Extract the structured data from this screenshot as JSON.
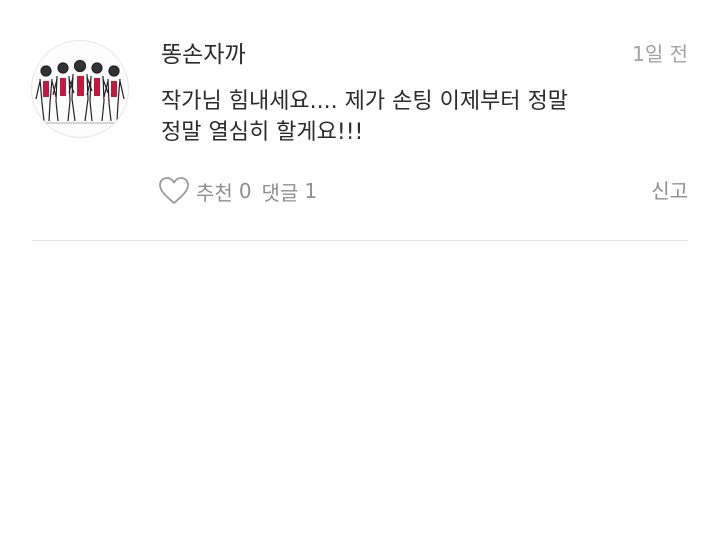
{
  "comment": {
    "author": "똥손자까",
    "time_ago": "1일 전",
    "text_line1": "작가님 힘내세요.... 제가 손팅 이제부터 정말",
    "text_line2": "정말 열심히 할게요!!!",
    "avatar_icon": "group-illustration-avatar",
    "actions": {
      "like_label": "추천",
      "like_count": "0",
      "reply_label": "댓글",
      "reply_count": "1",
      "report_label": "신고"
    }
  },
  "colors": {
    "text": "#2b2b2b",
    "muted": "#a3a3a3",
    "action": "#8f8f8f",
    "divider": "#e2e2e2",
    "accent": "#c4183c"
  }
}
